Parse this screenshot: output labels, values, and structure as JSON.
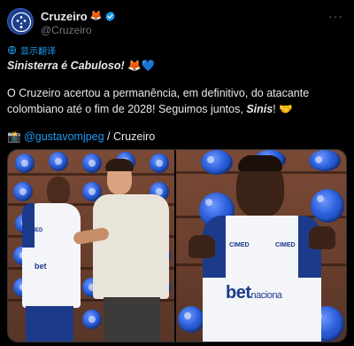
{
  "account": {
    "name": "Cruzeiro",
    "name_emoji": "🦊",
    "handle": "@Cruzeiro",
    "more_label": "···"
  },
  "translate": {
    "label": "显示翻译"
  },
  "tweet": {
    "line1_text": "Sinisterra é Cabuloso!",
    "line1_emojis": "🦊💙",
    "body_text": "O Cruzeiro acertou a permanência, em definitivo, do atacante colombiano até o fim de 2028! Seguimos juntos, ",
    "body_italic": "Sinis",
    "body_end": "! 🤝",
    "credit_emoji": "📸",
    "credit_link": "@gustavomjpeg",
    "credit_suffix": " / Cruzeiro"
  },
  "media": {
    "left_jersey_text": "CIMED",
    "left_sponsor": "bet",
    "right_jersey_left": "CIMED",
    "right_jersey_right": "CIMED",
    "right_sponsor_main": "bet",
    "right_sponsor_sub": "naciona"
  },
  "colors": {
    "accent": "#1d9bf0",
    "background": "#000000",
    "text": "#e7e9ea",
    "muted": "#71767b",
    "cruzeiro_blue": "#1c3a8a"
  },
  "icons": {
    "avatar": "cruzeiro-crest-icon",
    "verified": "verified-badge-icon",
    "translate": "globe-icon",
    "more": "more-options-icon"
  }
}
